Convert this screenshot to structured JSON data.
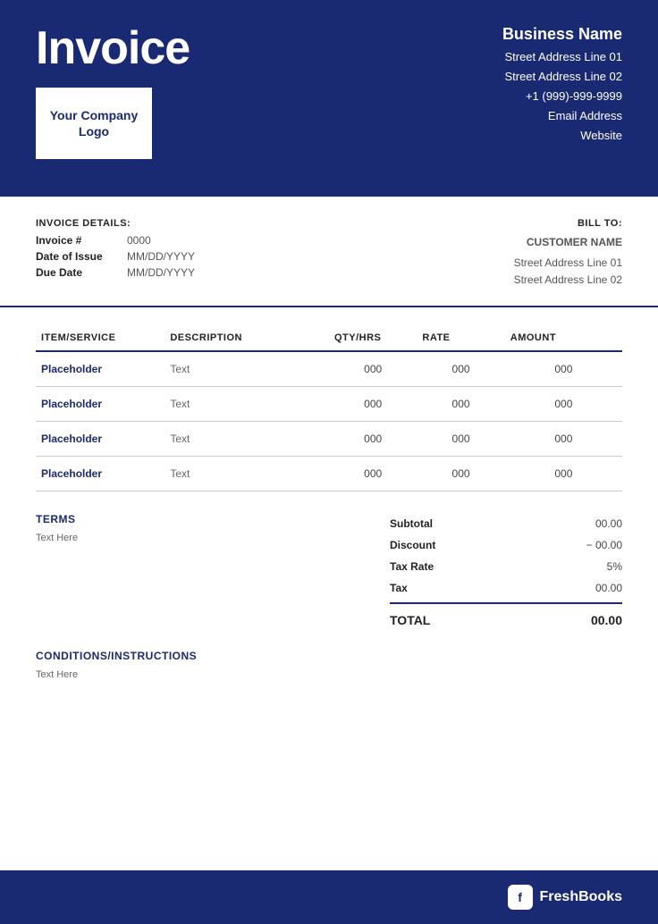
{
  "header": {
    "title": "Invoice",
    "logo_text_line1": "Your Company",
    "logo_text_line2": "Logo",
    "business": {
      "name": "Business Name",
      "address1": "Street Address Line 01",
      "address2": "Street Address Line 02",
      "phone": "+1 (999)-999-9999",
      "email": "Email Address",
      "website": "Website"
    }
  },
  "invoice_details": {
    "section_label": "INVOICE DETAILS:",
    "fields": [
      {
        "label": "Invoice #",
        "value": "0000"
      },
      {
        "label": "Date of Issue",
        "value": "MM/DD/YYYY"
      },
      {
        "label": "Due Date",
        "value": "MM/DD/YYYY"
      }
    ]
  },
  "bill_to": {
    "section_label": "BILL TO:",
    "customer_name": "CUSTOMER NAME",
    "address1": "Street Address Line 01",
    "address2": "Street Address Line 02"
  },
  "table": {
    "headers": {
      "item": "ITEM/SERVICE",
      "description": "DESCRIPTION",
      "qty": "QTY/HRS",
      "rate": "RATE",
      "amount": "AMOUNT"
    },
    "rows": [
      {
        "item": "Placeholder",
        "description": "Text",
        "qty": "000",
        "rate": "000",
        "amount": "000"
      },
      {
        "item": "Placeholder",
        "description": "Text",
        "qty": "000",
        "rate": "000",
        "amount": "000"
      },
      {
        "item": "Placeholder",
        "description": "Text",
        "qty": "000",
        "rate": "000",
        "amount": "000"
      },
      {
        "item": "Placeholder",
        "description": "Text",
        "qty": "000",
        "rate": "000",
        "amount": "000"
      }
    ]
  },
  "terms": {
    "title": "TERMS",
    "text": "Text Here"
  },
  "totals": {
    "subtotal_label": "Subtotal",
    "subtotal_value": "00.00",
    "discount_label": "Discount",
    "discount_value": "− 00.00",
    "taxrate_label": "Tax Rate",
    "taxrate_value": "5%",
    "tax_label": "Tax",
    "tax_value": "00.00",
    "total_label": "TOTAL",
    "total_value": "00.00"
  },
  "conditions": {
    "title": "CONDITIONS/INSTRUCTIONS",
    "text": "Text Here"
  },
  "footer": {
    "brand": "FreshBooks",
    "icon_letter": "f"
  }
}
